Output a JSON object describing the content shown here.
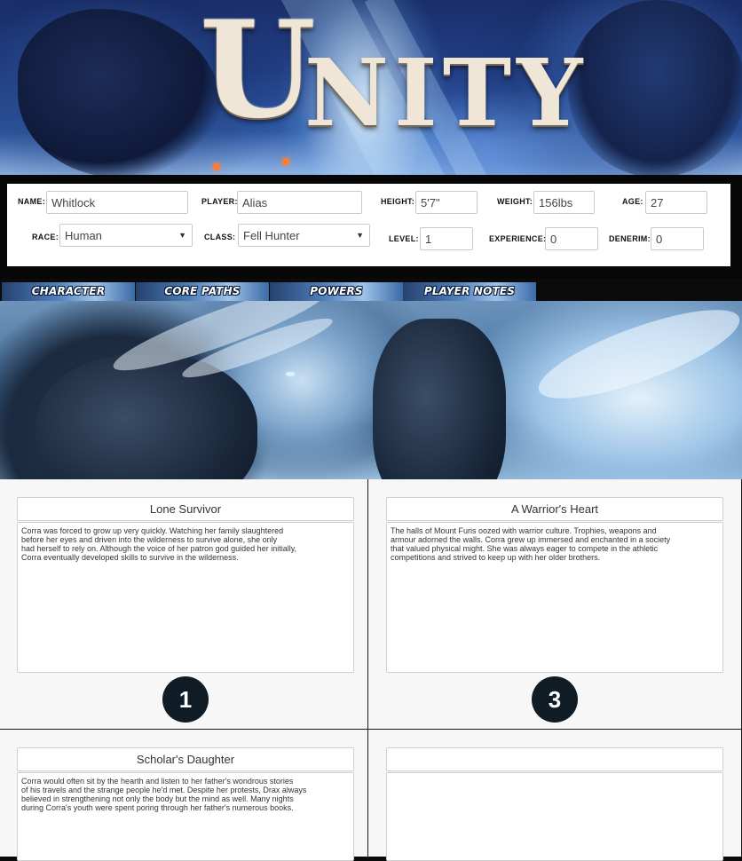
{
  "banner": {
    "logo_first": "U",
    "logo_rest": "NITY"
  },
  "character": {
    "name_label": "NAME:",
    "name_value": "Whitlock",
    "player_label": "PLAYER:",
    "player_value": "Alias",
    "height_label": "HEIGHT:",
    "height_value": "5'7\"",
    "weight_label": "WEIGHT:",
    "weight_value": "156lbs",
    "age_label": "AGE:",
    "age_value": "27",
    "race_label": "RACE:",
    "race_value": "Human",
    "class_label": "CLASS:",
    "class_value": "Fell Hunter",
    "level_label": "LEVEL:",
    "level_value": "1",
    "experience_label": "EXPERIENCE:",
    "experience_value": "0",
    "denerim_label": "DENERIM:",
    "denerim_value": "0"
  },
  "tabs": [
    {
      "label": "CHARACTER"
    },
    {
      "label": "CORE PATHS"
    },
    {
      "label": "POWERS"
    },
    {
      "label": "PLAYER NOTES"
    }
  ],
  "cards": [
    {
      "title": "Lone Survivor",
      "body": "Corra was forced to grow up very quickly. Watching her family slaughtered\nbefore her eyes and driven into the wilderness to survive alone, she only\nhad herself to rely on. Although the voice of her patron god guided her initially,\nCorra eventually developed skills to survive in the wilderness.",
      "badge": "1"
    },
    {
      "title": "A Warrior's Heart",
      "body": "The halls of Mount Furis oozed with warrior culture. Trophies, weapons and\narmour adorned the walls. Corra grew up immersed and enchanted in a society\nthat valued physical might. She was always eager to compete in the athletic\ncompetitions and strived to keep up with her older brothers.",
      "badge": "3"
    },
    {
      "title": "Scholar's Daughter",
      "body": "Corra would often sit by the hearth and listen to her father's wondrous stories\nof his travels and the strange people he'd met. Despite her protests, Drax always\nbelieved in strengthening not only the body but the mind as well. Many nights\nduring Corra's youth were spent poring through her father's numerous books.",
      "badge": ""
    },
    {
      "title": "",
      "body": "",
      "badge": ""
    }
  ],
  "icons": {
    "select_arrow": "▼"
  }
}
